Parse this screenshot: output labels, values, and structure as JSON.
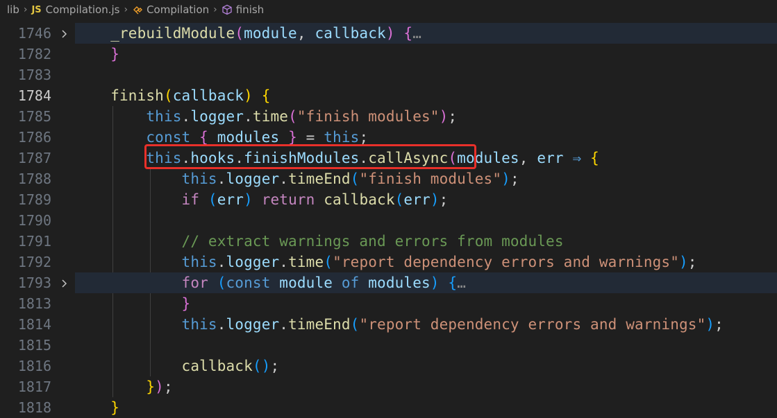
{
  "breadcrumb": {
    "folder": "lib",
    "file_badge": "JS",
    "file": "Compilation.js",
    "class_name": "Compilation",
    "method": "finish",
    "icons": [
      "chevron-right-icon",
      "class-icon",
      "method-cube-icon"
    ]
  },
  "editor": {
    "active_line": "1784",
    "lines": [
      {
        "num": "1746",
        "fold": true,
        "highlight": true,
        "tokens": [
          [
            "    ",
            "plain"
          ],
          [
            "_rebuildModule",
            "fn"
          ],
          [
            "(",
            "b2"
          ],
          [
            "module",
            "var"
          ],
          [
            ", ",
            "plain"
          ],
          [
            "callback",
            "var"
          ],
          [
            ")",
            "b2"
          ],
          [
            " ",
            "plain"
          ],
          [
            "{",
            "b2"
          ],
          [
            "…",
            "dots"
          ]
        ]
      },
      {
        "num": "1782",
        "tokens": [
          [
            "    ",
            "plain"
          ],
          [
            "}",
            "b2"
          ]
        ]
      },
      {
        "num": "1783",
        "tokens": []
      },
      {
        "num": "1784",
        "tokens": [
          [
            "    ",
            "plain"
          ],
          [
            "finish",
            "fn"
          ],
          [
            "(",
            "b1"
          ],
          [
            "callback",
            "var"
          ],
          [
            ")",
            "b1"
          ],
          [
            " ",
            "plain"
          ],
          [
            "{",
            "b1"
          ]
        ]
      },
      {
        "num": "1785",
        "tokens": [
          [
            "        ",
            "plain"
          ],
          [
            "this",
            "kw"
          ],
          [
            ".",
            "plain"
          ],
          [
            "logger",
            "var"
          ],
          [
            ".",
            "plain"
          ],
          [
            "time",
            "fn"
          ],
          [
            "(",
            "b2"
          ],
          [
            "\"finish modules\"",
            "str"
          ],
          [
            ")",
            "b2"
          ],
          [
            ";",
            "plain"
          ]
        ]
      },
      {
        "num": "1786",
        "tokens": [
          [
            "        ",
            "plain"
          ],
          [
            "const",
            "kw"
          ],
          [
            " ",
            "plain"
          ],
          [
            "{",
            "b2"
          ],
          [
            " ",
            "plain"
          ],
          [
            "modules",
            "var"
          ],
          [
            " ",
            "plain"
          ],
          [
            "}",
            "b2"
          ],
          [
            " = ",
            "plain"
          ],
          [
            "this",
            "kw"
          ],
          [
            ";",
            "plain"
          ]
        ]
      },
      {
        "num": "1787",
        "tokens": [
          [
            "        ",
            "plain"
          ],
          [
            "this",
            "kw"
          ],
          [
            ".",
            "plain"
          ],
          [
            "hooks",
            "var"
          ],
          [
            ".",
            "plain"
          ],
          [
            "finishModules",
            "var"
          ],
          [
            ".",
            "plain"
          ],
          [
            "callAsync",
            "fn"
          ],
          [
            "(",
            "b2"
          ],
          [
            "modules",
            "var"
          ],
          [
            ", ",
            "plain"
          ],
          [
            "err",
            "var"
          ],
          [
            " ",
            "plain"
          ],
          [
            "⇒",
            "kw"
          ],
          [
            " ",
            "plain"
          ],
          [
            "{",
            "b1"
          ]
        ]
      },
      {
        "num": "1788",
        "tokens": [
          [
            "            ",
            "plain"
          ],
          [
            "this",
            "kw"
          ],
          [
            ".",
            "plain"
          ],
          [
            "logger",
            "var"
          ],
          [
            ".",
            "plain"
          ],
          [
            "timeEnd",
            "fn"
          ],
          [
            "(",
            "b3"
          ],
          [
            "\"finish modules\"",
            "str"
          ],
          [
            ")",
            "b3"
          ],
          [
            ";",
            "plain"
          ]
        ]
      },
      {
        "num": "1789",
        "tokens": [
          [
            "            ",
            "plain"
          ],
          [
            "if",
            "ctrl"
          ],
          [
            " ",
            "plain"
          ],
          [
            "(",
            "b3"
          ],
          [
            "err",
            "var"
          ],
          [
            ")",
            "b3"
          ],
          [
            " ",
            "plain"
          ],
          [
            "return",
            "ctrl"
          ],
          [
            " ",
            "plain"
          ],
          [
            "callback",
            "fn"
          ],
          [
            "(",
            "b3"
          ],
          [
            "err",
            "var"
          ],
          [
            ")",
            "b3"
          ],
          [
            ";",
            "plain"
          ]
        ]
      },
      {
        "num": "1790",
        "tokens": []
      },
      {
        "num": "1791",
        "tokens": [
          [
            "            ",
            "plain"
          ],
          [
            "// extract warnings and errors from modules",
            "cmt"
          ]
        ]
      },
      {
        "num": "1792",
        "tokens": [
          [
            "            ",
            "plain"
          ],
          [
            "this",
            "kw"
          ],
          [
            ".",
            "plain"
          ],
          [
            "logger",
            "var"
          ],
          [
            ".",
            "plain"
          ],
          [
            "time",
            "fn"
          ],
          [
            "(",
            "b3"
          ],
          [
            "\"report dependency errors and warnings\"",
            "str"
          ],
          [
            ")",
            "b3"
          ],
          [
            ";",
            "plain"
          ]
        ]
      },
      {
        "num": "1793",
        "fold": true,
        "highlight": true,
        "tokens": [
          [
            "            ",
            "plain"
          ],
          [
            "for",
            "ctrl"
          ],
          [
            " ",
            "plain"
          ],
          [
            "(",
            "b3"
          ],
          [
            "const",
            "kw"
          ],
          [
            " ",
            "plain"
          ],
          [
            "module",
            "var"
          ],
          [
            " ",
            "plain"
          ],
          [
            "of",
            "kw"
          ],
          [
            " ",
            "plain"
          ],
          [
            "modules",
            "var"
          ],
          [
            ")",
            "b3"
          ],
          [
            " ",
            "plain"
          ],
          [
            "{",
            "b3"
          ],
          [
            "…",
            "dots"
          ]
        ]
      },
      {
        "num": "1813",
        "tokens": [
          [
            "            ",
            "plain"
          ],
          [
            "}",
            "b2"
          ]
        ]
      },
      {
        "num": "1814",
        "tokens": [
          [
            "            ",
            "plain"
          ],
          [
            "this",
            "kw"
          ],
          [
            ".",
            "plain"
          ],
          [
            "logger",
            "var"
          ],
          [
            ".",
            "plain"
          ],
          [
            "timeEnd",
            "fn"
          ],
          [
            "(",
            "b3"
          ],
          [
            "\"report dependency errors and warnings\"",
            "str"
          ],
          [
            ")",
            "b3"
          ],
          [
            ";",
            "plain"
          ]
        ]
      },
      {
        "num": "1815",
        "tokens": []
      },
      {
        "num": "1816",
        "tokens": [
          [
            "            ",
            "plain"
          ],
          [
            "callback",
            "fn"
          ],
          [
            "(",
            "b3"
          ],
          [
            ")",
            "b3"
          ],
          [
            ";",
            "plain"
          ]
        ]
      },
      {
        "num": "1817",
        "tokens": [
          [
            "        ",
            "plain"
          ],
          [
            "}",
            "b1"
          ],
          [
            ")",
            "b2"
          ],
          [
            ";",
            "plain"
          ]
        ]
      },
      {
        "num": "1818",
        "tokens": [
          [
            "    ",
            "plain"
          ],
          [
            "}",
            "b1"
          ]
        ]
      }
    ]
  },
  "colors": {
    "background": "#1f1f1f",
    "highlight_box": "#e8302a",
    "keyword": "#569cd6",
    "function": "#dcdcaa",
    "variable": "#9cdcfe",
    "string": "#ce9178",
    "comment": "#6a9955"
  }
}
